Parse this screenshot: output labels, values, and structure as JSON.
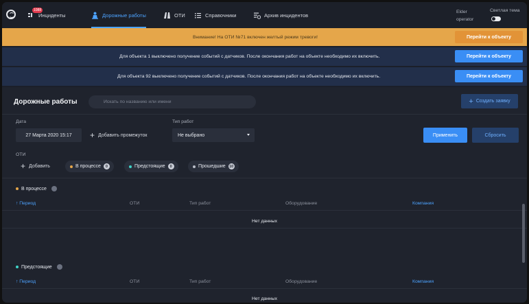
{
  "nav": {
    "items": [
      {
        "label": "Инциденты",
        "badge": "1088",
        "icon": "incidents-icon"
      },
      {
        "label": "Дорожные работы",
        "icon": "roadwork-worker-icon",
        "active": true
      },
      {
        "label": "ОТИ",
        "icon": "oti-vehicle-icon"
      },
      {
        "label": "Справочники",
        "icon": "list-icon"
      },
      {
        "label": "Архив инцидентов",
        "icon": "archive-icon"
      }
    ],
    "user": {
      "name": "Elder",
      "role": "operator"
    },
    "theme_label": "Светлая тема"
  },
  "banners": [
    {
      "text": "Внимание! На ОТИ №71 включен желтый режим тревоги!",
      "button": "Перейти к объекту",
      "type": "warning"
    },
    {
      "text": "Для объекта 1 выключено получение событий с датчиков. После окончания работ на объекте необходимо их включить.",
      "button": "Перейти к объекту",
      "type": "info"
    },
    {
      "text": "Для объекта 92 выключено получение событий с датчиков. После окончания работ на объекте необходимо их включить.",
      "button": "Перейти к объекту",
      "type": "info"
    }
  ],
  "page": {
    "title": "Дорожные работы",
    "search_placeholder": "Искать по названию или имени",
    "create_label": "Создать заявку"
  },
  "filters": {
    "date_label": "Дата",
    "date_value": "27 Марта 2020 15:17",
    "add_interval": "Добавить промежуток",
    "work_type_label": "Тип работ",
    "work_type_value": "Не выбрано",
    "apply": "Применить",
    "reset": "Сбросить",
    "oti_label": "ОТИ",
    "add_oti": "Добавить",
    "chips": [
      {
        "label": "В процессе",
        "count": "0",
        "dot_color": "#e5a64a"
      },
      {
        "label": "Предстоящие",
        "count": "0",
        "dot_color": "#3fd2c7"
      },
      {
        "label": "Прошедшие",
        "count": "10",
        "dot_color": "#b8bdc7"
      }
    ]
  },
  "sections": [
    {
      "title": "В процессе",
      "dot_color": "#e5a64a",
      "columns": [
        "Период",
        "ОТИ",
        "Тип работ",
        "Оборудование",
        "Компания"
      ],
      "empty": "Нет данных"
    },
    {
      "title": "Предстоящие",
      "dot_color": "#3fd2c7",
      "columns": [
        "Период",
        "ОТИ",
        "Тип работ",
        "Оборудование",
        "Компания"
      ],
      "empty": "Нет данных"
    }
  ]
}
